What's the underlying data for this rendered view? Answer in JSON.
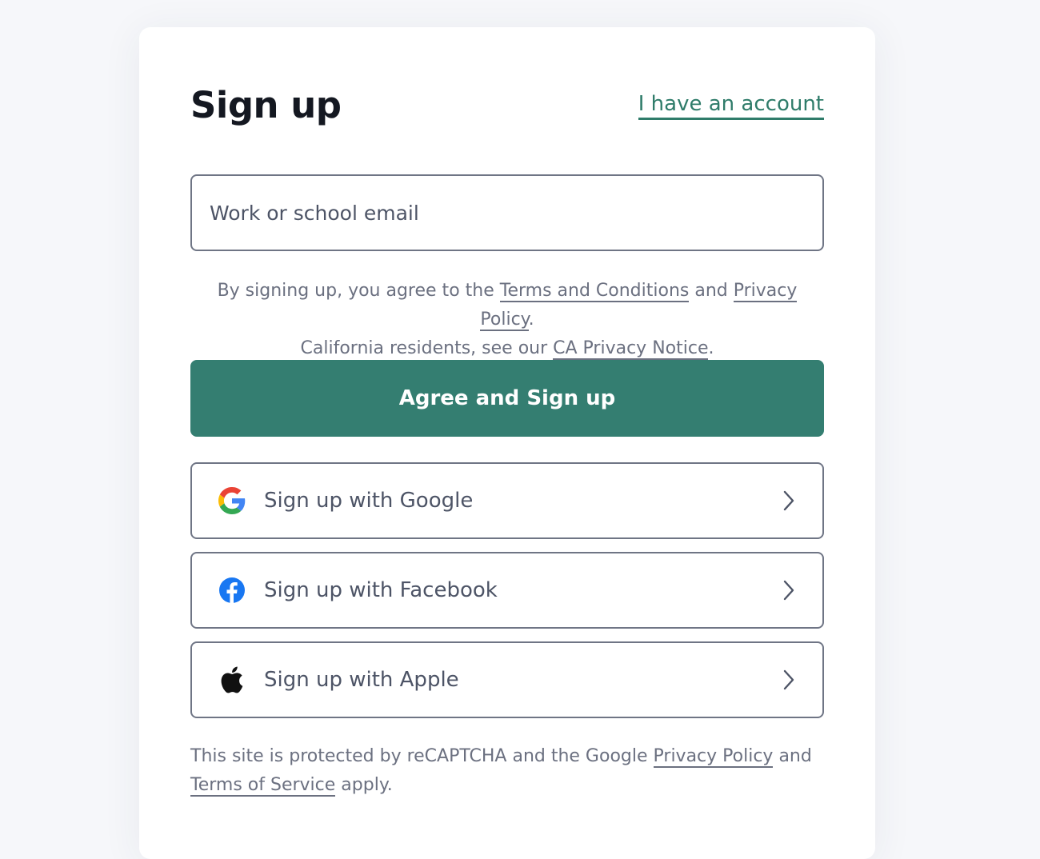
{
  "header": {
    "title": "Sign up",
    "login_link": "I have an account"
  },
  "form": {
    "email_placeholder": "Work or school email",
    "email_value": ""
  },
  "legal": {
    "prefix": "By signing up, you agree to the ",
    "terms_link": "Terms and Conditions",
    "and": " and ",
    "privacy_link": "Privacy Policy",
    "dot1": ".",
    "line2_prefix": "California residents, see our ",
    "ca_link": "CA Privacy Notice",
    "dot2": "."
  },
  "primary_button": {
    "label": "Agree and Sign up"
  },
  "social_buttons": [
    {
      "label": "Sign up with Google",
      "icon": "google-icon"
    },
    {
      "label": "Sign up with Facebook",
      "icon": "facebook-icon"
    },
    {
      "label": "Sign up with Apple",
      "icon": "apple-icon"
    }
  ],
  "recaptcha": {
    "prefix": "This site is protected by reCAPTCHA and the Google ",
    "privacy_link": "Privacy Policy",
    "and": " and",
    "terms_link": "Terms of Service",
    "suffix": " apply."
  },
  "colors": {
    "accent": "#347e71",
    "link": "#2f7c6a",
    "text": "#141821",
    "muted": "#6b7080",
    "border": "#6f7585",
    "background": "#f6f7fa"
  }
}
